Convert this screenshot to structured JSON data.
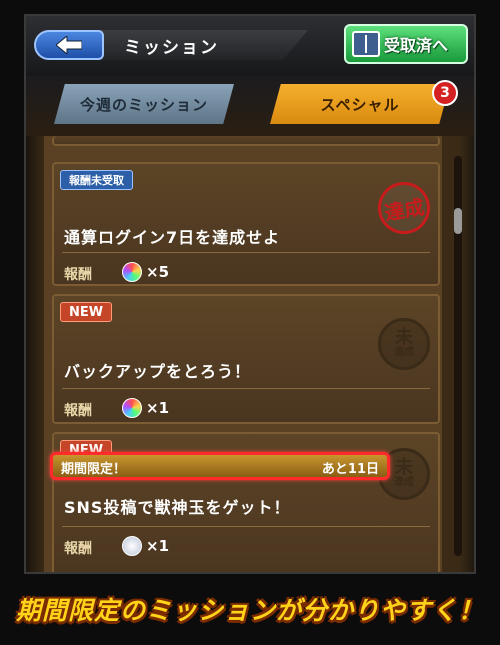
{
  "header": {
    "title": "ミッション",
    "received_button_label": "受取済へ"
  },
  "tabs": [
    {
      "label": "今週のミッション",
      "active": false
    },
    {
      "label": "スペシャル",
      "active": true,
      "badge": "3"
    }
  ],
  "missions": [
    {
      "tag": "報酬未受取",
      "text": "通算ログイン7日を達成せよ",
      "reward_label": "報酬",
      "reward_count": "×5",
      "stamp": "達成"
    },
    {
      "tag": "NEW",
      "text": "バックアップをとろう！",
      "reward_label": "報酬",
      "reward_count": "×1",
      "stamp_top": "未",
      "stamp_bottom": "達成"
    },
    {
      "tag": "NEW",
      "limited_label": "期間限定！",
      "limited_days": "あと11日",
      "text": "SNS投稿で獣神玉をゲット！",
      "reward_label": "報酬",
      "reward_count": "×1",
      "stamp_top": "未",
      "stamp_bottom": "達成"
    }
  ],
  "caption": "期間限定のミッションが分かりやすく！",
  "colors": {
    "accent_orange": "#f6b02c",
    "highlight_red": "#ff2a2a",
    "caption_yellow": "#ffd31a"
  }
}
